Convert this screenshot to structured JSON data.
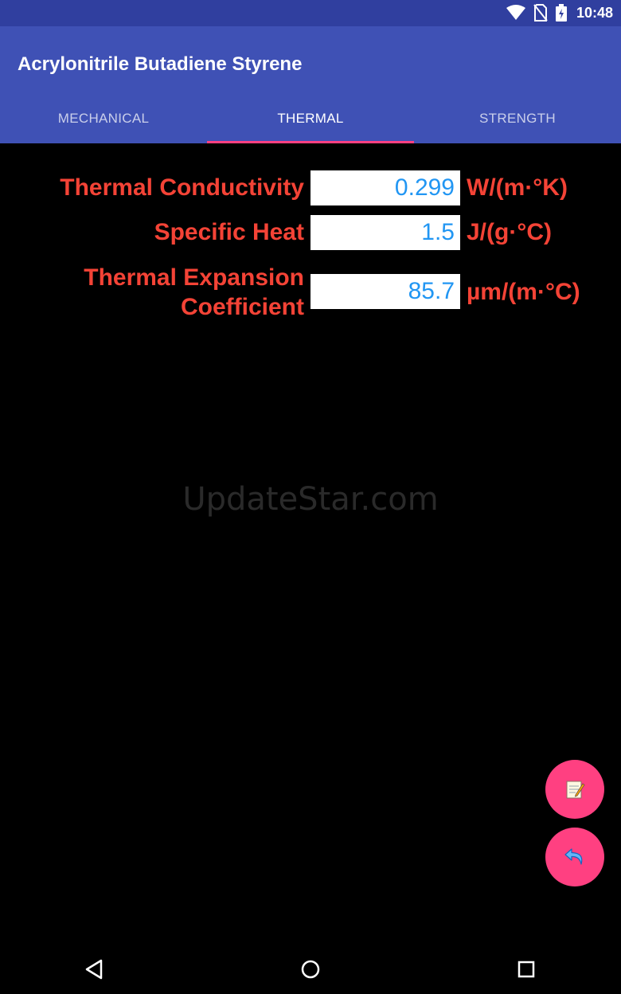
{
  "status_bar": {
    "time": "10:48",
    "icons": [
      "wifi-icon",
      "no-sim-icon",
      "battery-icon"
    ]
  },
  "app": {
    "title": "Acrylonitrile Butadiene Styrene"
  },
  "tabs": [
    {
      "label": "MECHANICAL",
      "active": false
    },
    {
      "label": "THERMAL",
      "active": true
    },
    {
      "label": "STRENGTH",
      "active": false
    }
  ],
  "properties": {
    "thermal_conductivity": {
      "label": "Thermal Conductivity",
      "value": "0.299",
      "unit": "W/(m·°K)"
    },
    "specific_heat": {
      "label": "Specific Heat",
      "value": "1.5",
      "unit": "J/(g·°C)"
    },
    "thermal_expansion": {
      "label_line1": "Thermal Expansion",
      "label_line2": "Coefficient",
      "value": "85.7",
      "unit": "µm/(m·°C)"
    }
  },
  "watermark": "UpdateStar.com",
  "fabs": {
    "notes_icon": "notepad-icon",
    "back_icon": "undo-arrow-icon"
  },
  "navigation": {
    "icons": [
      "back-triangle-icon",
      "home-circle-icon",
      "recents-square-icon"
    ]
  },
  "colors": {
    "primary": "#3F51B5",
    "primary_dark": "#303F9F",
    "accent": "#FF4081",
    "label_red": "#F44336",
    "value_blue": "#2196F3"
  }
}
